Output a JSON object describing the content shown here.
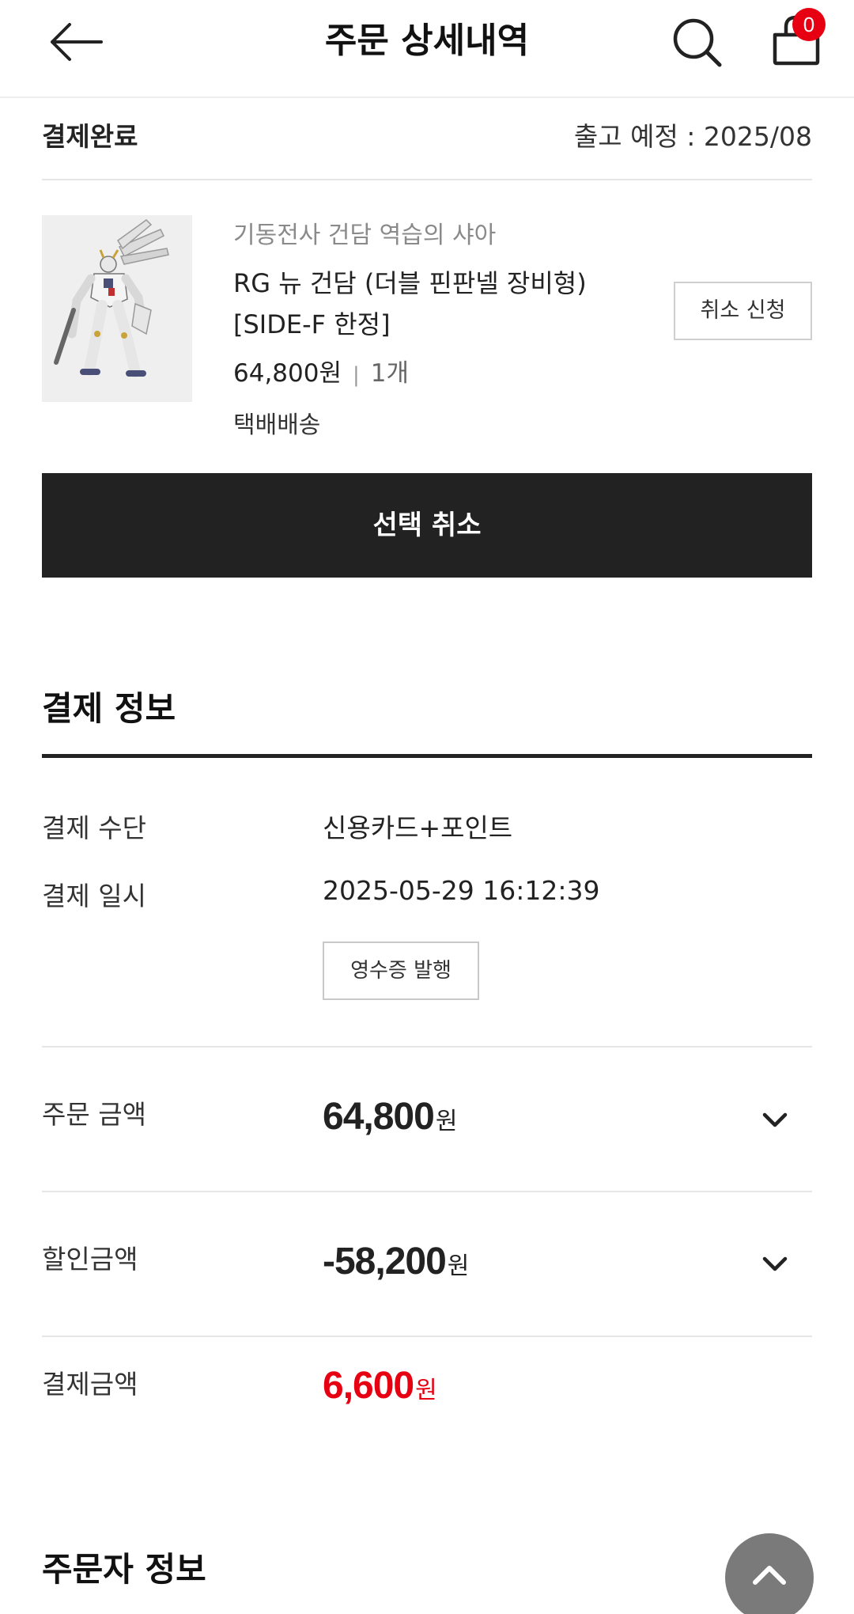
{
  "header": {
    "title": "주문 상세내역",
    "cart_count": "0"
  },
  "order": {
    "status": "결제완료",
    "ship_date": "출고 예정 : 2025/08"
  },
  "product": {
    "brand": "기동전사 건담 역습의 샤아",
    "name": "RG 뉴 건담 (더블 핀판넬 장비형) [SIDE-F 한정]",
    "price": "64,800원",
    "separator": "|",
    "quantity": "1개",
    "delivery": "택배배송",
    "cancel_label": "취소 신청"
  },
  "select_cancel_label": "선택 취소",
  "payment": {
    "title": "결제 정보",
    "method_label": "결제 수단",
    "method_value": "신용카드+포인트",
    "date_label": "결제 일시",
    "date_value": "2025-05-29 16:12:39",
    "receipt_label": "영수증 발행",
    "order_amount_label": "주문 금액",
    "order_amount": "64,800",
    "discount_label": "할인금액",
    "discount_amount": "-58,200",
    "final_label": "결제금액",
    "final_amount": "6,600",
    "unit": "원"
  },
  "orderer": {
    "title": "주문자 정보"
  },
  "icons": {
    "back": "arrow-left-icon",
    "search": "search-icon",
    "cart": "shopping-bag-icon",
    "chevron": "chevron-down-icon",
    "top": "chevron-up-icon"
  },
  "colors": {
    "accent_red": "#e60012",
    "button_dark": "#222222"
  }
}
